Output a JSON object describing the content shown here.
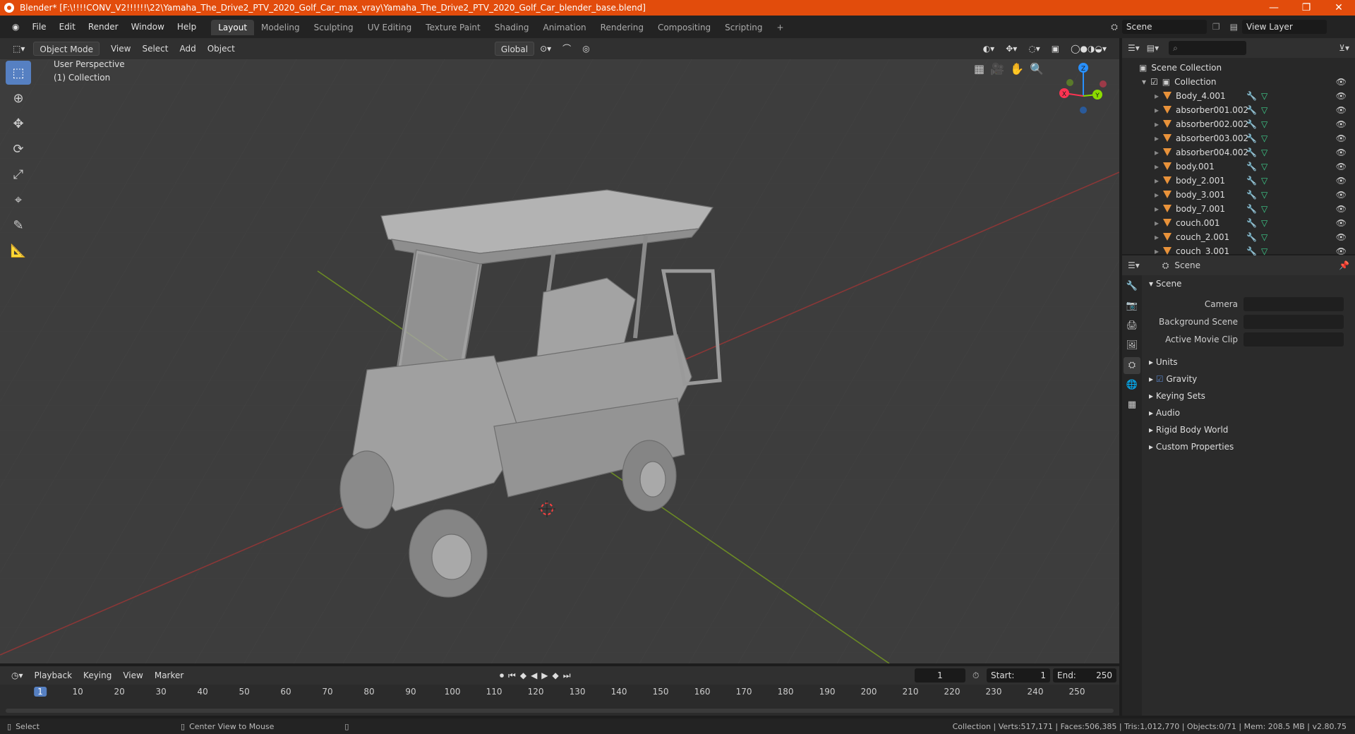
{
  "title": "Blender* [F:\\!!!!CONV_V2!!!!!!\\22\\Yamaha_The_Drive2_PTV_2020_Golf_Car_max_vray\\Yamaha_The_Drive2_PTV_2020_Golf_Car_blender_base.blend]",
  "window_buttons": [
    "—",
    "❐",
    "✕"
  ],
  "menu": [
    "File",
    "Edit",
    "Render",
    "Window",
    "Help"
  ],
  "workspaces": [
    "Layout",
    "Modeling",
    "Sculpting",
    "UV Editing",
    "Texture Paint",
    "Shading",
    "Animation",
    "Rendering",
    "Compositing",
    "Scripting"
  ],
  "add_tab": "+",
  "scene_field": "Scene",
  "view_layer_field": "View Layer",
  "viewport_header": {
    "mode": "Object Mode",
    "menus": [
      "View",
      "Select",
      "Add",
      "Object"
    ],
    "transform": "Global"
  },
  "viewport": {
    "perspective": "User Perspective",
    "collection": "(1) Collection",
    "gizmo_axes": [
      "X",
      "Y",
      "Z"
    ]
  },
  "outliner": {
    "root": "Scene Collection",
    "collection": "Collection",
    "items": [
      "Body_4.001",
      "absorber001.002",
      "absorber002.002",
      "absorber003.002",
      "absorber004.002",
      "body.001",
      "body_2.001",
      "body_3.001",
      "body_7.001",
      "couch.001",
      "couch_2.001",
      "couch_3.001"
    ]
  },
  "properties": {
    "header": "Scene",
    "panel": "Scene",
    "fields": [
      "Camera",
      "Background Scene",
      "Active Movie Clip"
    ],
    "sections": [
      "Units",
      "Gravity",
      "Keying Sets",
      "Audio",
      "Rigid Body World",
      "Custom Properties"
    ]
  },
  "timeline": {
    "menus": [
      "Playback",
      "Keying",
      "View",
      "Marker"
    ],
    "current_frame": "1",
    "start_label": "Start:",
    "start": "1",
    "end_label": "End:",
    "end": "250",
    "ticks": [
      "1",
      "10",
      "20",
      "30",
      "40",
      "50",
      "60",
      "70",
      "80",
      "90",
      "100",
      "110",
      "120",
      "130",
      "140",
      "150",
      "160",
      "170",
      "180",
      "190",
      "200",
      "210",
      "220",
      "230",
      "240",
      "250"
    ]
  },
  "statusbar": {
    "select": "Select",
    "center": "Center View to Mouse",
    "stats": "Collection | Verts:517,171 | Faces:506,385 | Tris:1,012,770 | Objects:0/71 | Mem: 208.5 MB | v2.80.75"
  },
  "colors": {
    "accent": "#5680c2",
    "title_bar": "#e24c0c",
    "mesh": "#e8923a",
    "x_axis": "#ff3352",
    "y_axis": "#8bdc00",
    "z_axis": "#2890ff"
  }
}
